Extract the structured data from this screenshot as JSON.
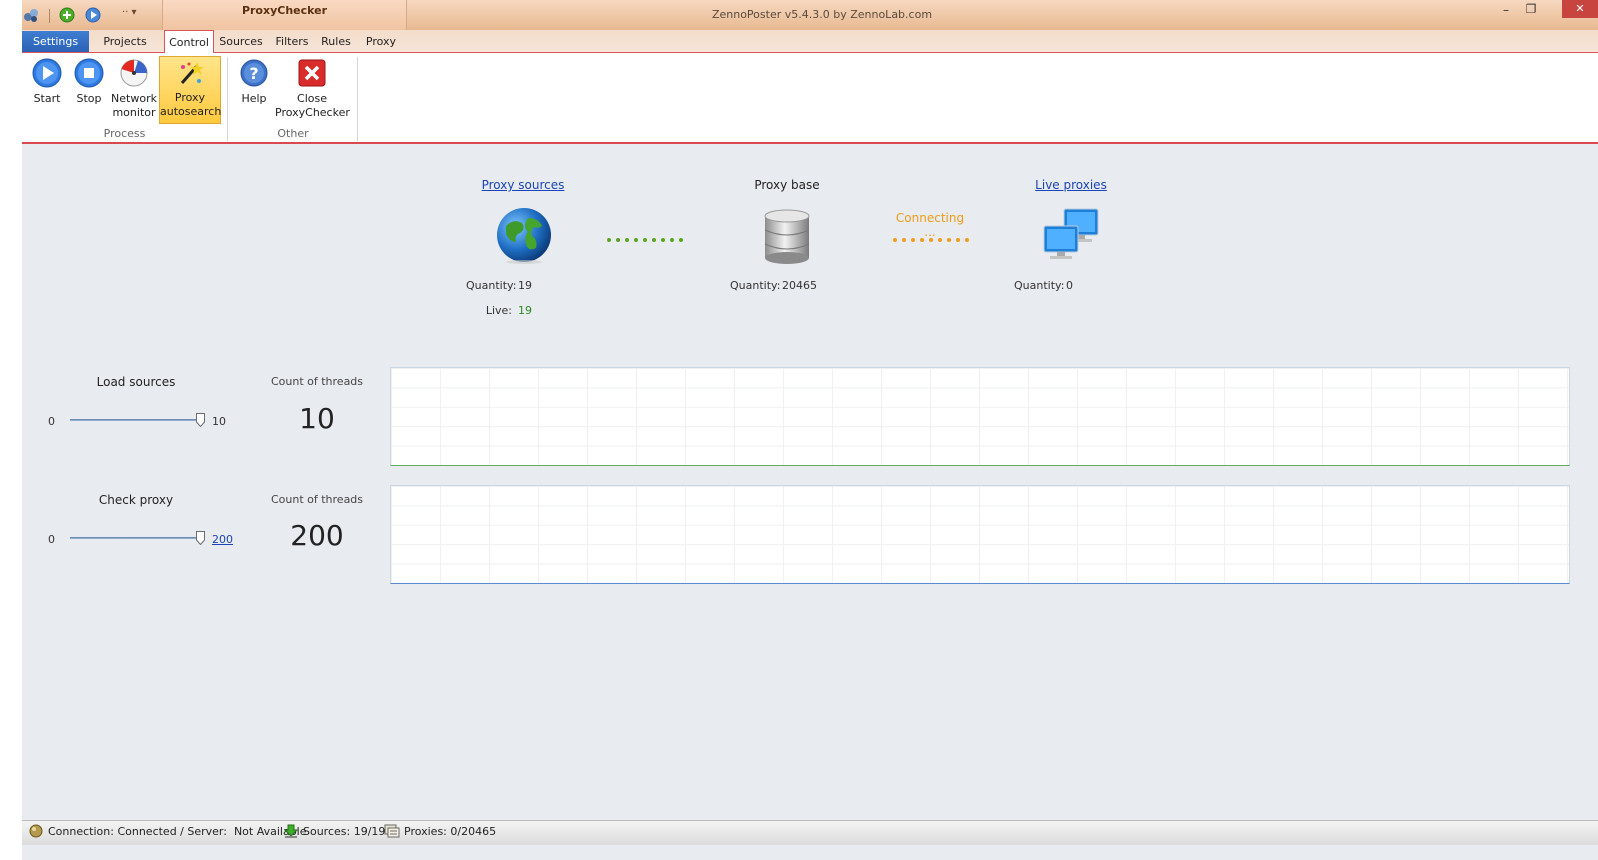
{
  "window": {
    "title": "ZennoPoster v5.4.3.0 by ZennoLab.com",
    "context_tab": "ProxyChecker",
    "quick_access_more": "··",
    "controls": {
      "minimize": "–",
      "restore": "❐",
      "close": "✕"
    }
  },
  "tabs": [
    {
      "label": "Settings",
      "state": "file"
    },
    {
      "label": "Projects",
      "state": "normal"
    },
    {
      "label": "Control",
      "state": "active"
    },
    {
      "label": "Sources",
      "state": "normal"
    },
    {
      "label": "Filters",
      "state": "normal"
    },
    {
      "label": "Rules",
      "state": "normal"
    },
    {
      "label": "Proxy",
      "state": "normal"
    }
  ],
  "ribbon": {
    "groups": [
      {
        "label": "Process",
        "buttons": [
          {
            "label": "Start",
            "icon": "play-icon"
          },
          {
            "label": "Stop",
            "icon": "stop-icon"
          },
          {
            "label": "Network monitor",
            "icon": "network-monitor-icon"
          },
          {
            "label": "Proxy autosearch",
            "icon": "magic-wand-icon",
            "active": true
          }
        ]
      },
      {
        "label": "Other",
        "buttons": [
          {
            "label": "Help",
            "icon": "help-icon"
          },
          {
            "label": "Close ProxyChecker",
            "icon": "close-red-icon"
          }
        ]
      }
    ]
  },
  "pipeline": {
    "sources": {
      "title": "Proxy sources ",
      "quantity_label": "Quantity:",
      "quantity": "19",
      "live_label": "Live:",
      "live": "19"
    },
    "base": {
      "title": "Proxy base",
      "quantity_label": "Quantity:",
      "quantity": "20465"
    },
    "connector_status": "Connecting ...",
    "live": {
      "title": "Live proxies",
      "quantity_label": "Quantity:",
      "quantity": "0"
    }
  },
  "load_sources": {
    "title": "Load sources",
    "threads_label": "Count of threads",
    "threads": "10",
    "slider_min": "0",
    "slider_max": "10",
    "slider_value_fraction": 1.0
  },
  "check_proxy": {
    "title": "Check proxy",
    "threads_label": "Count of threads",
    "threads": "200",
    "slider_min": "0",
    "slider_max": "200",
    "slider_value_fraction": 1.0
  },
  "statusbar": {
    "connection": "Connection: Connected / Server:  Not Available",
    "sources": "Sources: 19/19",
    "proxies": "Proxies: 0/20465"
  },
  "colors": {
    "accent_red": "#d84a4f",
    "link_blue": "#1a45b8",
    "green_dots": "#5aa520",
    "orange_connecting": "#f29b1a",
    "live_green": "#2c8a1e",
    "graph1_border": "#5fae5a",
    "graph2_border": "#5a8ad0"
  }
}
